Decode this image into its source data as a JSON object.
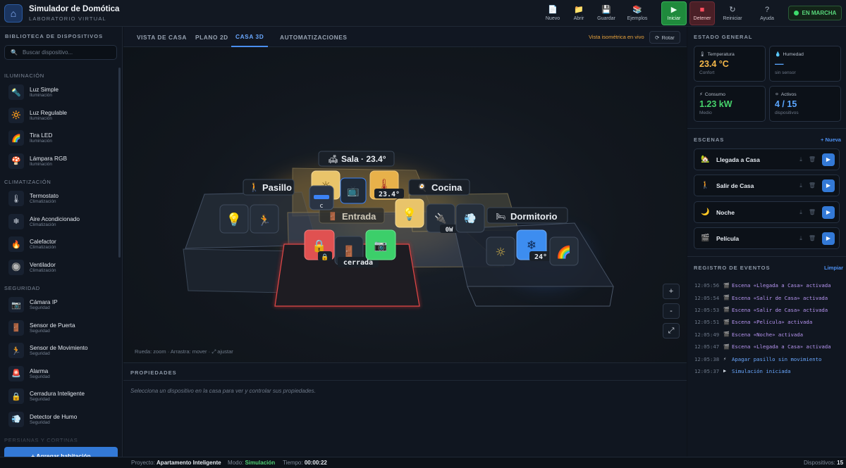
{
  "app": {
    "title": "Simulador de Domótica",
    "subtitle": "LABORATORIO VIRTUAL",
    "logo_icon": "home-icon"
  },
  "toolbar": [
    {
      "id": "new",
      "label": "Nuevo",
      "icon": "file-icon"
    },
    {
      "id": "open",
      "label": "Abrir",
      "icon": "folder-icon"
    },
    {
      "id": "save",
      "label": "Guardar",
      "icon": "disk-icon"
    },
    {
      "id": "examples",
      "label": "Ejemplos",
      "icon": "books-icon"
    },
    {
      "id": "start",
      "label": "Iniciar",
      "icon": "play-icon"
    },
    {
      "id": "stop",
      "label": "Detener",
      "icon": "stop-icon"
    },
    {
      "id": "reset",
      "label": "Reiniciar",
      "icon": "refresh-icon"
    },
    {
      "id": "help",
      "label": "Ayuda",
      "icon": "question-icon"
    }
  ],
  "status": {
    "label": "EN MARCHA",
    "color": "#3ddc6c"
  },
  "library": {
    "title": "BIBLIOTECA DE DISPOSITIVOS",
    "search_placeholder": "Buscar dispositivo...",
    "categories": [
      {
        "name": "ILUMINACIÓN",
        "items": [
          {
            "name": "Luz Simple",
            "category": "Iluminación",
            "icon": "🔦"
          },
          {
            "name": "Luz Regulable",
            "category": "Iluminación",
            "icon": "🔆"
          },
          {
            "name": "Tira LED",
            "category": "Iluminación",
            "icon": "🌈"
          },
          {
            "name": "Lámpara RGB",
            "category": "Iluminación",
            "icon": "🍄"
          }
        ]
      },
      {
        "name": "CLIMATIZACIÓN",
        "items": [
          {
            "name": "Termostato",
            "category": "Climatización",
            "icon": "🌡"
          },
          {
            "name": "Aire Acondicionado",
            "category": "Climatización",
            "icon": "❄"
          },
          {
            "name": "Calefactor",
            "category": "Climatización",
            "icon": "🔥"
          },
          {
            "name": "Ventilador",
            "category": "Climatización",
            "icon": "🔘"
          }
        ]
      },
      {
        "name": "SEGURIDAD",
        "items": [
          {
            "name": "Cámara IP",
            "category": "Seguridad",
            "icon": "📷"
          },
          {
            "name": "Sensor de Puerta",
            "category": "Seguridad",
            "icon": "🚪"
          },
          {
            "name": "Sensor de Movimiento",
            "category": "Seguridad",
            "icon": "🏃"
          },
          {
            "name": "Alarma",
            "category": "Seguridad",
            "icon": "🚨"
          },
          {
            "name": "Cerradura Inteligente",
            "category": "Seguridad",
            "icon": "🔒"
          },
          {
            "name": "Detector de Humo",
            "category": "Seguridad",
            "icon": "💨"
          }
        ]
      },
      {
        "name": "PERSIANAS Y CORTINAS",
        "items": []
      }
    ],
    "add_room": "+ Agregar habitación"
  },
  "tabs": [
    {
      "label": "VISTA DE CASA",
      "active": false
    },
    {
      "label": "PLANO 2D",
      "active": false
    },
    {
      "label": "CASA 3D",
      "active": true
    },
    {
      "label": "AUTOMATIZACIONES",
      "active": false
    }
  ],
  "view": {
    "info": "Vista isométrica en vivo",
    "rotate": "Rotar",
    "hint": "Rueda: zoom · Arrastra: mover · ⤢ ajustar",
    "zoom_in": "+",
    "zoom_out": "-",
    "fit": "⤢",
    "rooms": [
      {
        "name": "Sala · 23.4°",
        "icon": "🛋"
      },
      {
        "name": "Pasillo",
        "icon": "🚶"
      },
      {
        "name": "Cocina",
        "icon": "🍳"
      },
      {
        "name": "Entrada",
        "icon": "🚪"
      },
      {
        "name": "Dormitorio",
        "icon": "🛏"
      }
    ],
    "device_labels": {
      "sala_temp": "23.4°",
      "cocina_power": "0W",
      "door": "cerrada",
      "ac_temp": "24°",
      "sala_small": "c"
    }
  },
  "properties": {
    "title": "PROPIEDADES",
    "empty": "Selecciona un dispositivo en la casa para ver y controlar sus propiedades."
  },
  "overview": {
    "title": "ESTADO GENERAL",
    "stats": [
      {
        "label": "Temperatura",
        "value": "23.4 °C",
        "sub": "Confort",
        "color": "#f5b84a",
        "icon": "🌡"
      },
      {
        "label": "Humedad",
        "value": "—",
        "sub": "sin sensor",
        "color": "#5aa6ff",
        "icon": "💧"
      },
      {
        "label": "Consumo",
        "value": "1.23 kW",
        "sub": "Medio",
        "color": "#46d36b",
        "icon": "⚡"
      },
      {
        "label": "Activos",
        "value": "4 / 15",
        "sub": "dispositivos",
        "color": "#5aa6ff",
        "icon": "⚪"
      }
    ]
  },
  "scenes": {
    "title": "ESCENAS",
    "new": "+ Nueva",
    "items": [
      {
        "name": "Llegada a Casa",
        "icon": "🏡"
      },
      {
        "name": "Salir de Casa",
        "icon": "🚶"
      },
      {
        "name": "Noche",
        "icon": "🌙"
      },
      {
        "name": "Película",
        "icon": "🎬"
      }
    ]
  },
  "events": {
    "title": "REGISTRO DE EVENTOS",
    "clear": "Limpiar",
    "items": [
      {
        "time": "12:05:56",
        "icon": "🎬",
        "message": "Escena «Llegada a Casa» activada",
        "color": "#b694f0"
      },
      {
        "time": "12:05:54",
        "icon": "🎬",
        "message": "Escena «Salir de Casa» activada",
        "color": "#b694f0"
      },
      {
        "time": "12:05:53",
        "icon": "🎬",
        "message": "Escena «Salir de Casa» activada",
        "color": "#b694f0"
      },
      {
        "time": "12:05:51",
        "icon": "🎬",
        "message": "Escena «Película» activada",
        "color": "#b694f0"
      },
      {
        "time": "12:05:49",
        "icon": "🎬",
        "message": "Escena «Noche» activada",
        "color": "#b694f0"
      },
      {
        "time": "12:05:47",
        "icon": "🎬",
        "message": "Escena «Llegada a Casa» activada",
        "color": "#b694f0"
      },
      {
        "time": "12:05:38",
        "icon": "⚡",
        "message": "Apagar pasillo sin movimiento",
        "color": "#6aa8ff"
      },
      {
        "time": "12:05:37",
        "icon": "▶",
        "message": "Simulación iniciada",
        "color": "#6aa8ff"
      }
    ]
  },
  "statusbar": {
    "project_label": "Proyecto:",
    "project": "Apartamento Inteligente",
    "mode_label": "Modo:",
    "mode": "Simulación",
    "time_label": "Tiempo:",
    "time": "00:00:22",
    "devices_label": "Dispositivos:",
    "devices": "15"
  }
}
